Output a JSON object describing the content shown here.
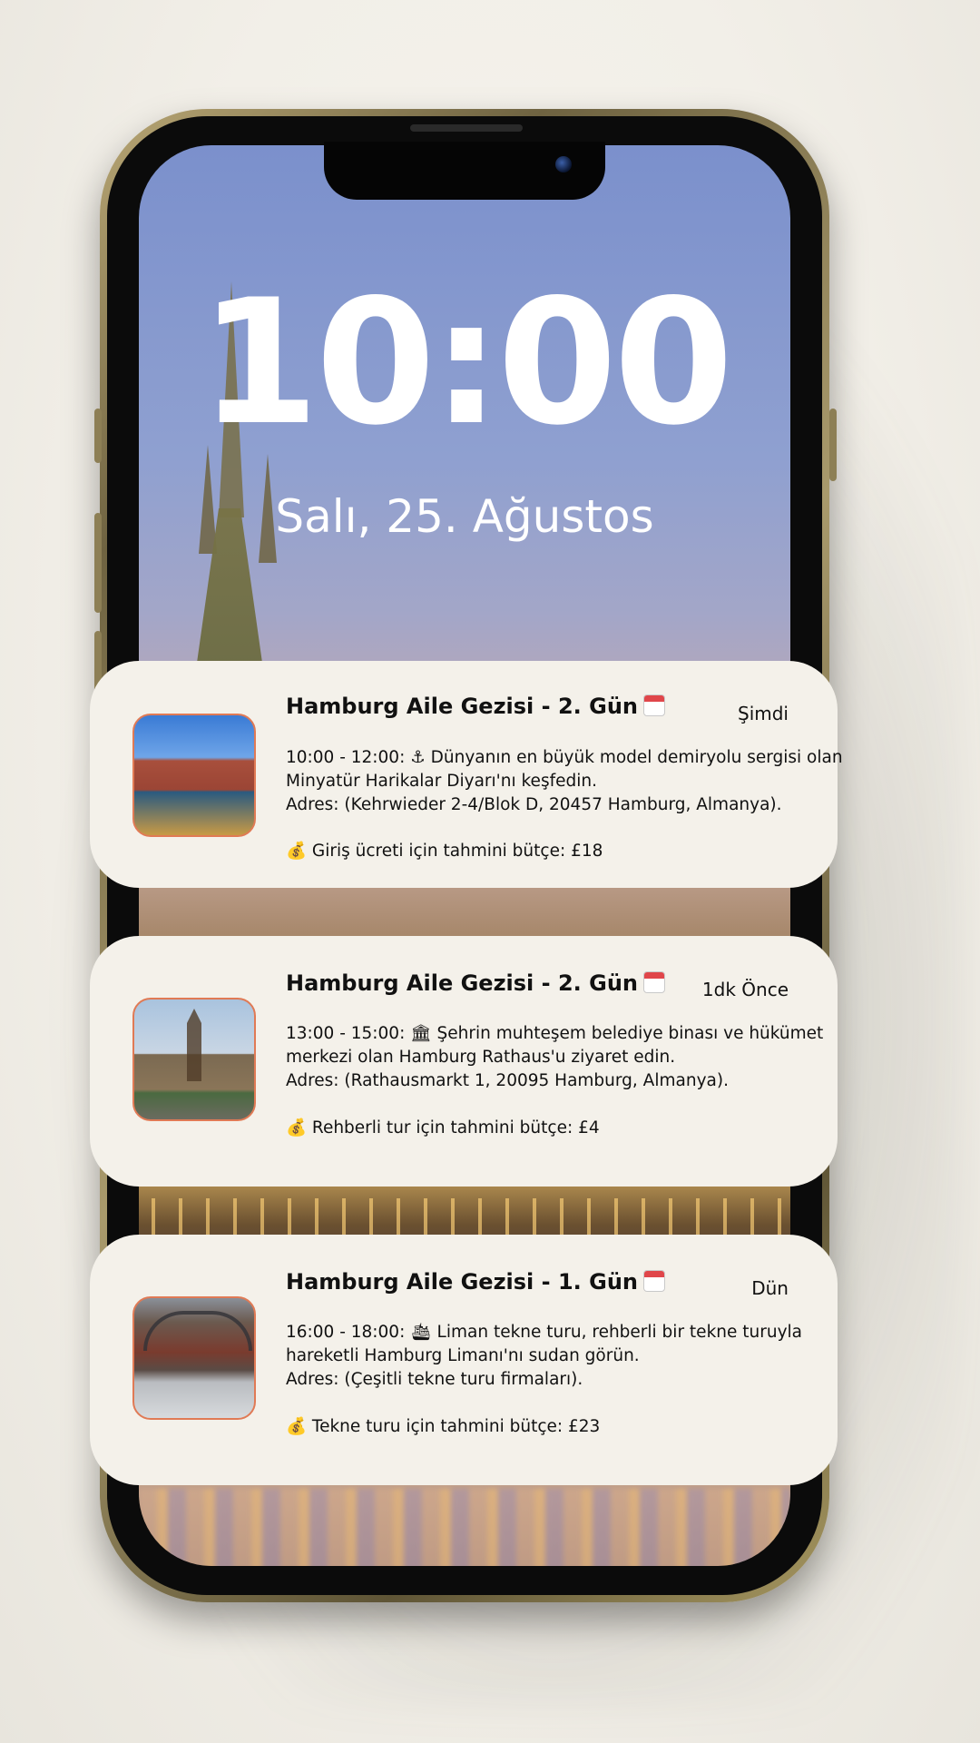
{
  "lockscreen": {
    "time": "10:00",
    "date": "Salı, 25. Ağustos"
  },
  "notifications": [
    {
      "title": "Hamburg Aile Gezisi - 2. Gün",
      "title_icon": "calendar-icon",
      "time": "Şimdi",
      "line1": "10:00 - 12:00: ⚓ Dünyanın en büyük model demiryolu sergisi olan",
      "line2": "Minyatür Harikalar Diyarı'nı keşfedin.",
      "line3": " Adres: (Kehrwieder 2-4/Blok D, 20457 Hamburg, Almanya).",
      "budget": "💰 Giriş ücreti için tahmini bütçe: £18",
      "thumbnail": "speicherstadt-photo"
    },
    {
      "title": "Hamburg Aile Gezisi - 2. Gün",
      "title_icon": "calendar-icon",
      "time": "1dk Önce",
      "line1": "13:00 - 15:00: 🏛 Şehrin muhteşem belediye binası ve hükümet",
      "line2": "merkezi olan Hamburg Rathaus'u ziyaret edin.",
      "line3": "Adres: (Rathausmarkt 1, 20095 Hamburg, Almanya).",
      "budget": "💰 Rehberli tur için tahmini bütçe: £4",
      "thumbnail": "rathaus-photo"
    },
    {
      "title": "Hamburg Aile Gezisi - 1. Gün",
      "title_icon": "calendar-icon",
      "time": "Dün",
      "line1": "16:00 - 18:00: 🛳 Liman tekne turu, rehberli bir tekne turuyla",
      "line2": "hareketli Hamburg Limanı'nı sudan görün.",
      "line3": "Adres: (Çeşitli tekne turu firmaları).",
      "budget": "💰 Tekne turu için tahmini bütçe: £23",
      "thumbnail": "canal-boat-photo"
    }
  ]
}
